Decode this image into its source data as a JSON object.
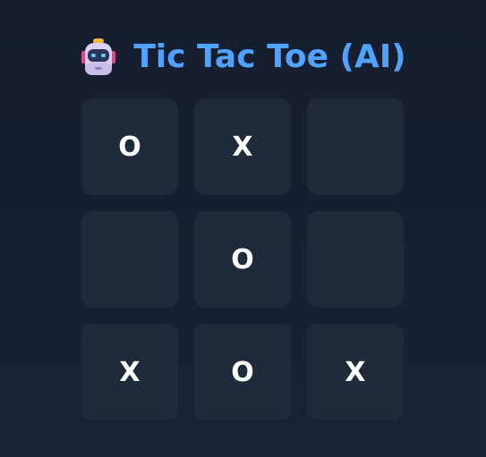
{
  "header": {
    "icon": "robot-icon",
    "title": "Tic Tac Toe (AI)"
  },
  "colors": {
    "title": "#4fa3ff",
    "cell_background": "#1f2a3b",
    "page_background": "#161e30",
    "mark": "#ffffff"
  },
  "board": {
    "cells": [
      "O",
      "X",
      "",
      "",
      "O",
      "",
      "X",
      "O",
      "X"
    ]
  }
}
